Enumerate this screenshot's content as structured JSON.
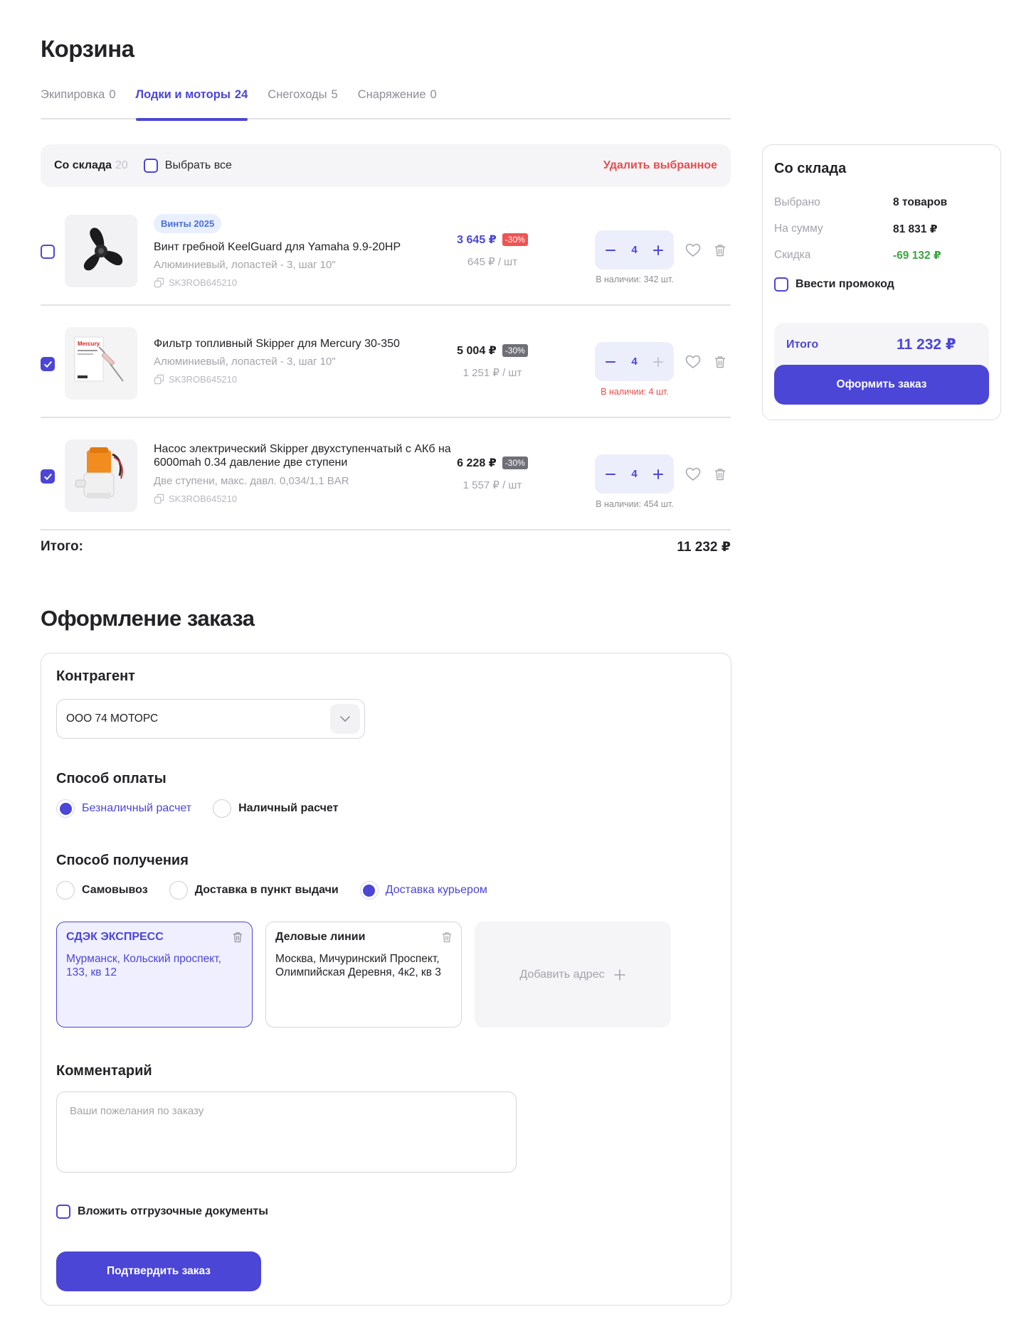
{
  "page": {
    "title": "Корзина"
  },
  "tabs": [
    {
      "label": "Экипировка",
      "count": "0"
    },
    {
      "label": "Лодки и моторы",
      "count": "24"
    },
    {
      "label": "Снегоходы",
      "count": "5"
    },
    {
      "label": "Снаряжение",
      "count": "0"
    }
  ],
  "toolbar": {
    "warehouse_label": "Со склада",
    "warehouse_count": "20",
    "select_all": "Выбрать все",
    "delete_selected": "Удалить выбранное"
  },
  "items": [
    {
      "tag": "Винты 2025",
      "name": "Винт гребной KeelGuard для Yamaha 9.9-20HP",
      "desc": "Алюминиевый, лопастей - 3, шаг 10\"",
      "sku": "SK3ROB645210",
      "price": "3 645 ₽",
      "discount": "-30%",
      "unit_price": "645 ₽ / шт",
      "qty": "4",
      "stock": "В наличии: 342 шт.",
      "checked": false
    },
    {
      "name": "Фильтр топливный Skipper для Mercury 30-350",
      "desc": "Алюминиевый, лопастей - 3, шаг 10\"",
      "sku": "SK3ROB645210",
      "price": "5 004 ₽",
      "discount": "-30%",
      "unit_price": "1 251 ₽ / шт",
      "qty": "4",
      "stock": "В наличии: 4 шт.",
      "checked": true
    },
    {
      "name": "Насос электрический Skipper двухступенчатый с АКб на 6000mah 0.34 давление две ступени",
      "desc": "Две ступени, макс. давл. 0,034/1,1 BAR",
      "sku": "SK3ROB645210",
      "price": "6 228 ₽",
      "discount": "-30%",
      "unit_price": "1 557 ₽ / шт",
      "qty": "4",
      "stock": "В наличии: 454 шт.",
      "checked": true
    }
  ],
  "cart_total": {
    "label": "Итого:",
    "value": "11 232 ₽"
  },
  "summary": {
    "title": "Со склада",
    "selected_label": "Выбрано",
    "selected_value": "8 товаров",
    "sum_label": "На сумму",
    "sum_value": "81 831 ₽",
    "discount_label": "Скидка",
    "discount_value": "-69 132 ₽",
    "promo": "Ввести промокод",
    "total_label": "Итого",
    "total_value": "11 232 ₽",
    "order_button": "Оформить заказ"
  },
  "checkout": {
    "title": "Оформление заказа",
    "counterparty_title": "Контрагент",
    "counterparty_value": "ООО 74 МОТОРС",
    "payment_title": "Способ оплаты",
    "payment_options": [
      "Безналичный расчет",
      "Наличный расчет"
    ],
    "delivery_title": "Способ получения",
    "delivery_options": [
      "Самовывоз",
      "Доставка в пункт выдачи",
      "Доставка курьером"
    ],
    "addresses": [
      {
        "title": "СДЭК ЭКСПРЕСС",
        "address": "Мурманск, Кольский проспект, 133, кв 12"
      },
      {
        "title": "Деловые линии",
        "address": "Москва, Мичуринский Проспект, Олимпийская Деревня, 4к2, кв 3"
      }
    ],
    "add_address": "Добавить адрес",
    "comment_title": "Комментарий",
    "comment_placeholder": "Ваши пожелания по заказу",
    "docs_label": "Вложить отгрузочные документы",
    "confirm_button": "Подтвердить заказ"
  },
  "colors": {
    "accent": "#4b46d6",
    "danger": "#eb4b4b",
    "success": "#3aa640"
  },
  "product_images": [
    "Mercury"
  ]
}
